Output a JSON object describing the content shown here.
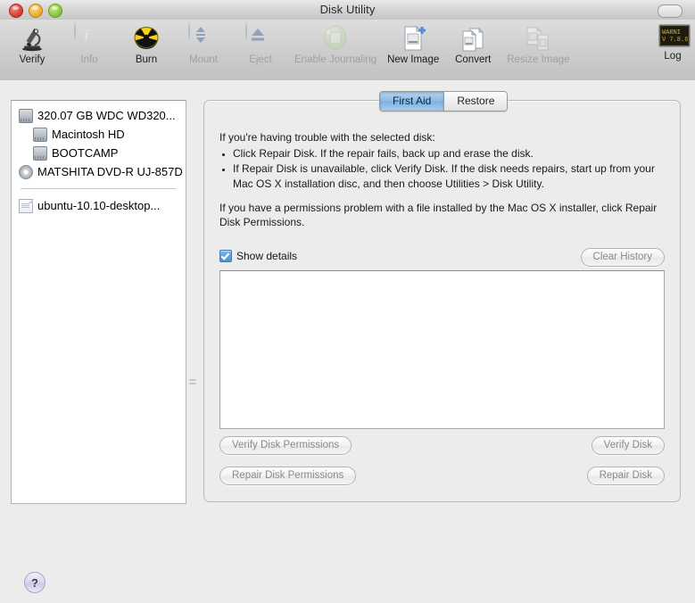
{
  "window": {
    "title": "Disk Utility",
    "traffic_lights": [
      "close",
      "minimize",
      "zoom"
    ],
    "toolbar_toggle": "toolbar-toggle"
  },
  "toolbar": {
    "items": [
      {
        "label": "Verify",
        "icon": "microscope-icon",
        "enabled": true
      },
      {
        "label": "Info",
        "icon": "info-icon",
        "enabled": false
      },
      {
        "label": "Burn",
        "icon": "burn-radiation-icon",
        "enabled": true
      },
      {
        "label": "Mount",
        "icon": "mount-updown-icon",
        "enabled": false
      },
      {
        "label": "Eject",
        "icon": "eject-icon",
        "enabled": false
      },
      {
        "label": "Enable Journaling",
        "icon": "journaling-sphere-icon",
        "enabled": false
      },
      {
        "label": "New Image",
        "icon": "new-image-icon",
        "enabled": true
      },
      {
        "label": "Convert",
        "icon": "convert-icon",
        "enabled": true
      },
      {
        "label": "Resize Image",
        "icon": "resize-image-icon",
        "enabled": false
      }
    ],
    "log": {
      "label": "Log",
      "icon": "log-console-icon"
    }
  },
  "sidebar": {
    "items": [
      {
        "label": "320.07 GB WDC WD320...",
        "icon": "hard-disk-icon",
        "indent": false
      },
      {
        "label": "Macintosh HD",
        "icon": "volume-icon",
        "indent": true
      },
      {
        "label": "BOOTCAMP",
        "icon": "volume-icon",
        "indent": true
      },
      {
        "label": "MATSHITA DVD-R UJ-857D",
        "icon": "optical-disc-icon",
        "indent": false
      }
    ],
    "images": [
      {
        "label": "ubuntu-10.10-desktop...",
        "icon": "disk-image-icon",
        "indent": false
      }
    ]
  },
  "panel": {
    "tabs": [
      {
        "label": "First Aid",
        "active": true
      },
      {
        "label": "Restore",
        "active": false
      }
    ],
    "help": {
      "intro": "If you're having trouble with the selected disk:",
      "bullets": [
        "Click Repair Disk. If the repair fails, back up and erase the disk.",
        "If Repair Disk is unavailable, click Verify Disk. If the disk needs repairs, start up from your Mac OS X installation disc, and then choose Utilities > Disk Utility."
      ],
      "permissions": "If you have a permissions problem with a file installed by the Mac OS X installer, click Repair Disk Permissions."
    },
    "show_details": {
      "label": "Show details",
      "checked": true
    },
    "clear_history": "Clear History",
    "log_output": "",
    "buttons": {
      "verify_permissions": "Verify Disk Permissions",
      "repair_permissions": "Repair Disk Permissions",
      "verify_disk": "Verify Disk",
      "repair_disk": "Repair Disk"
    }
  },
  "footer": {
    "help": "?"
  },
  "colors": {
    "accent_blue": "#7db0df",
    "checkbox_blue": "#4f8fd6",
    "window_bg": "#ececec",
    "titlebar": "#d4d4d4"
  }
}
